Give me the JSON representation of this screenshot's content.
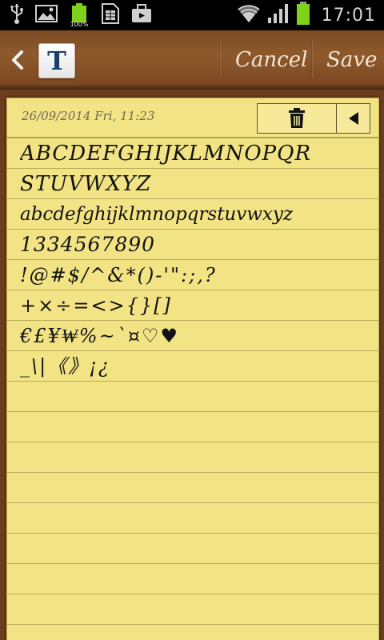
{
  "status_bar": {
    "battery_small_label": "100%",
    "time": "17:01",
    "icons": [
      "usb-icon",
      "image-icon",
      "battery-icon",
      "sim-icon",
      "briefcase-icon",
      "wifi-icon",
      "signal-icon",
      "battery-icon"
    ]
  },
  "toolbar": {
    "text_tool_letter": "T",
    "cancel_label": "Cancel",
    "save_label": "Save"
  },
  "note": {
    "date": "26/09/2014 Fri, 11:23",
    "lines": [
      "ABCDEFGHIJKLMNOPQR",
      "STUVWXYZ",
      "abcdefghijklmnopqrstuvwxyz",
      "1334567890",
      "!@#$/^&*()-'\":;,?",
      "+×÷=<>{}[]",
      "€£¥₩%~`¤♡♥",
      "_\\|《》¡¿"
    ]
  },
  "colors": {
    "wood": "#7b4a22",
    "paper": "#f2e384",
    "ink": "#121212",
    "battery_green": "#7fd21a"
  }
}
